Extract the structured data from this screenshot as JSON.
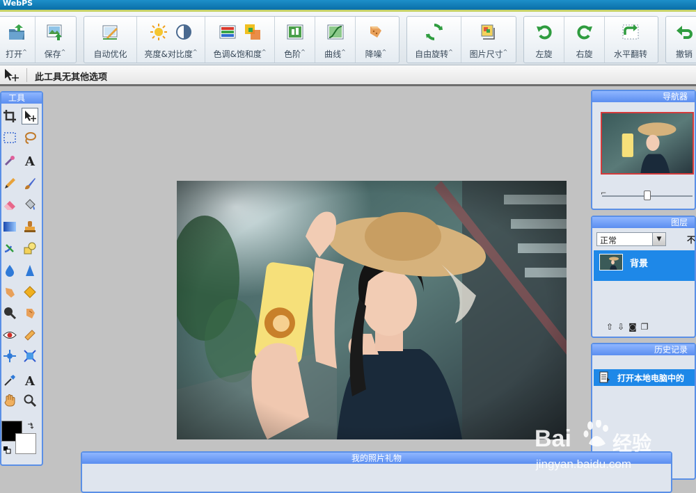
{
  "app": {
    "title": "WebPS"
  },
  "toolbar": {
    "file": [
      {
        "name": "open",
        "label": "打开",
        "arrow": "^"
      },
      {
        "name": "save",
        "label": "保存",
        "arrow": "^"
      }
    ],
    "adjust": [
      {
        "name": "auto-optimize",
        "label": "自动优化",
        "arrow": ""
      },
      {
        "name": "brightness-contrast",
        "label": "亮度&对比度",
        "arrow": "^"
      },
      {
        "name": "hue-saturation",
        "label": "色调&饱和度",
        "arrow": "^"
      },
      {
        "name": "levels",
        "label": "色阶",
        "arrow": "^"
      },
      {
        "name": "curves",
        "label": "曲线",
        "arrow": "^"
      },
      {
        "name": "denoise",
        "label": "降噪",
        "arrow": "^"
      }
    ],
    "transform": [
      {
        "name": "free-rotate",
        "label": "自由旋转",
        "arrow": "^"
      },
      {
        "name": "image-size",
        "label": "图片尺寸",
        "arrow": "^"
      }
    ],
    "rotate": [
      {
        "name": "rotate-left",
        "label": "左旋",
        "arrow": ""
      },
      {
        "name": "rotate-right",
        "label": "右旋",
        "arrow": ""
      },
      {
        "name": "flip-horizontal",
        "label": "水平翻转",
        "arrow": ""
      }
    ],
    "edit": [
      {
        "name": "undo",
        "label": "撤销",
        "arrow": ""
      }
    ]
  },
  "options_bar": {
    "text": "此工具无其他选项"
  },
  "tools_panel": {
    "title": "工具"
  },
  "navigator": {
    "title": "导航器",
    "zoom_level": 0.5
  },
  "layers": {
    "title": "图层",
    "blend_mode": "正常",
    "opacity_hint": "不",
    "items": [
      {
        "name": "背景",
        "selected": true
      }
    ]
  },
  "history": {
    "title": "历史记录",
    "items": [
      {
        "label": "打开本地电脑中的",
        "selected": true
      }
    ]
  },
  "gift_panel": {
    "title": "我的照片礼物"
  },
  "watermark": {
    "brand": "Bai",
    "brand_cn": "经验",
    "url": "jingyan.baidu.com"
  },
  "colors": {
    "accent": "#5b8ef0",
    "selection": "#1e88e8",
    "title_bar": "#0a6fa8"
  }
}
